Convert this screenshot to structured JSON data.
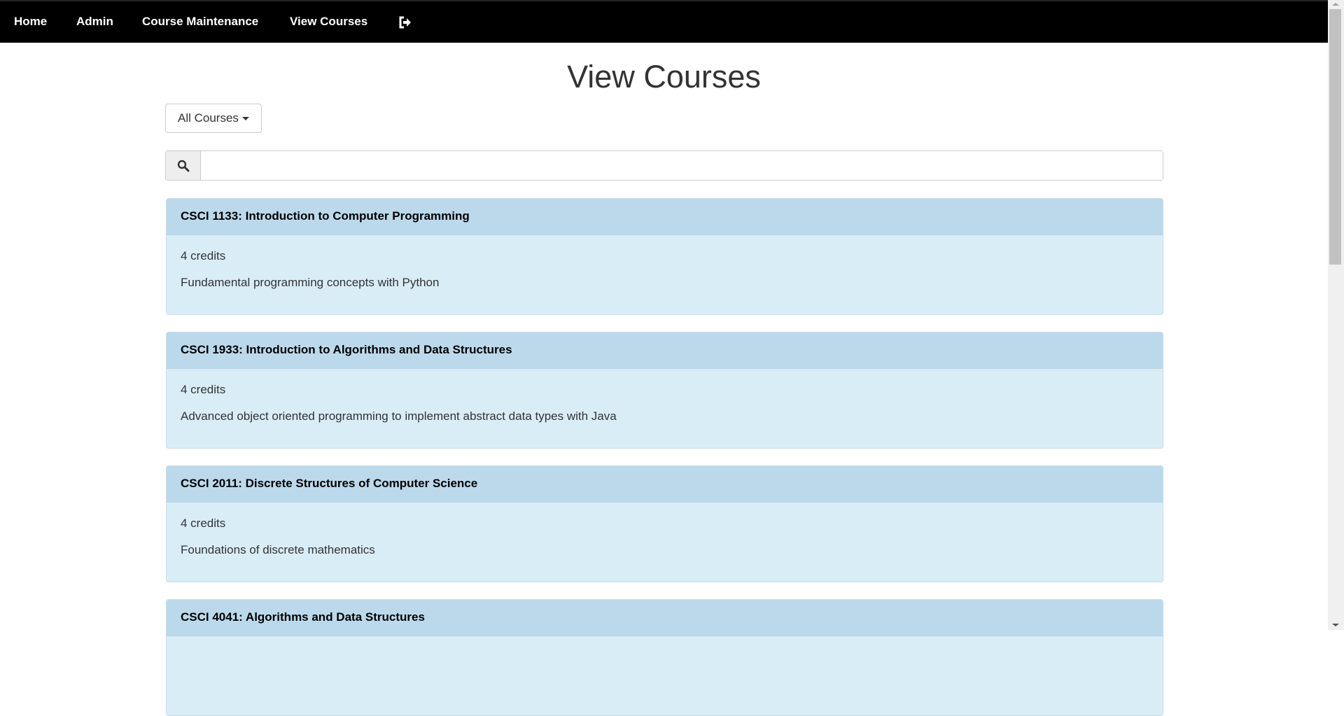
{
  "nav": {
    "items": [
      "Home",
      "Admin",
      "Course Maintenance",
      "View Courses"
    ],
    "logout_icon": "logout-icon"
  },
  "page": {
    "title": "View Courses"
  },
  "filter": {
    "selected": "All Courses"
  },
  "search": {
    "value": "",
    "placeholder": ""
  },
  "courses": [
    {
      "title": "CSCI 1133: Introduction to Computer Programming",
      "credits": "4 credits",
      "description": "Fundamental programming concepts with Python"
    },
    {
      "title": "CSCI 1933: Introduction to Algorithms and Data Structures",
      "credits": "4 credits",
      "description": "Advanced object oriented programming to implement abstract data types with Java"
    },
    {
      "title": "CSCI 2011: Discrete Structures of Computer Science",
      "credits": "4 credits",
      "description": "Foundations of discrete mathematics"
    },
    {
      "title": "CSCI 4041: Algorithms and Data Structures"
    }
  ],
  "colors": {
    "nav": "#000000",
    "panel_heading": "#bcd9ec",
    "panel_body": "#d9edf7"
  }
}
